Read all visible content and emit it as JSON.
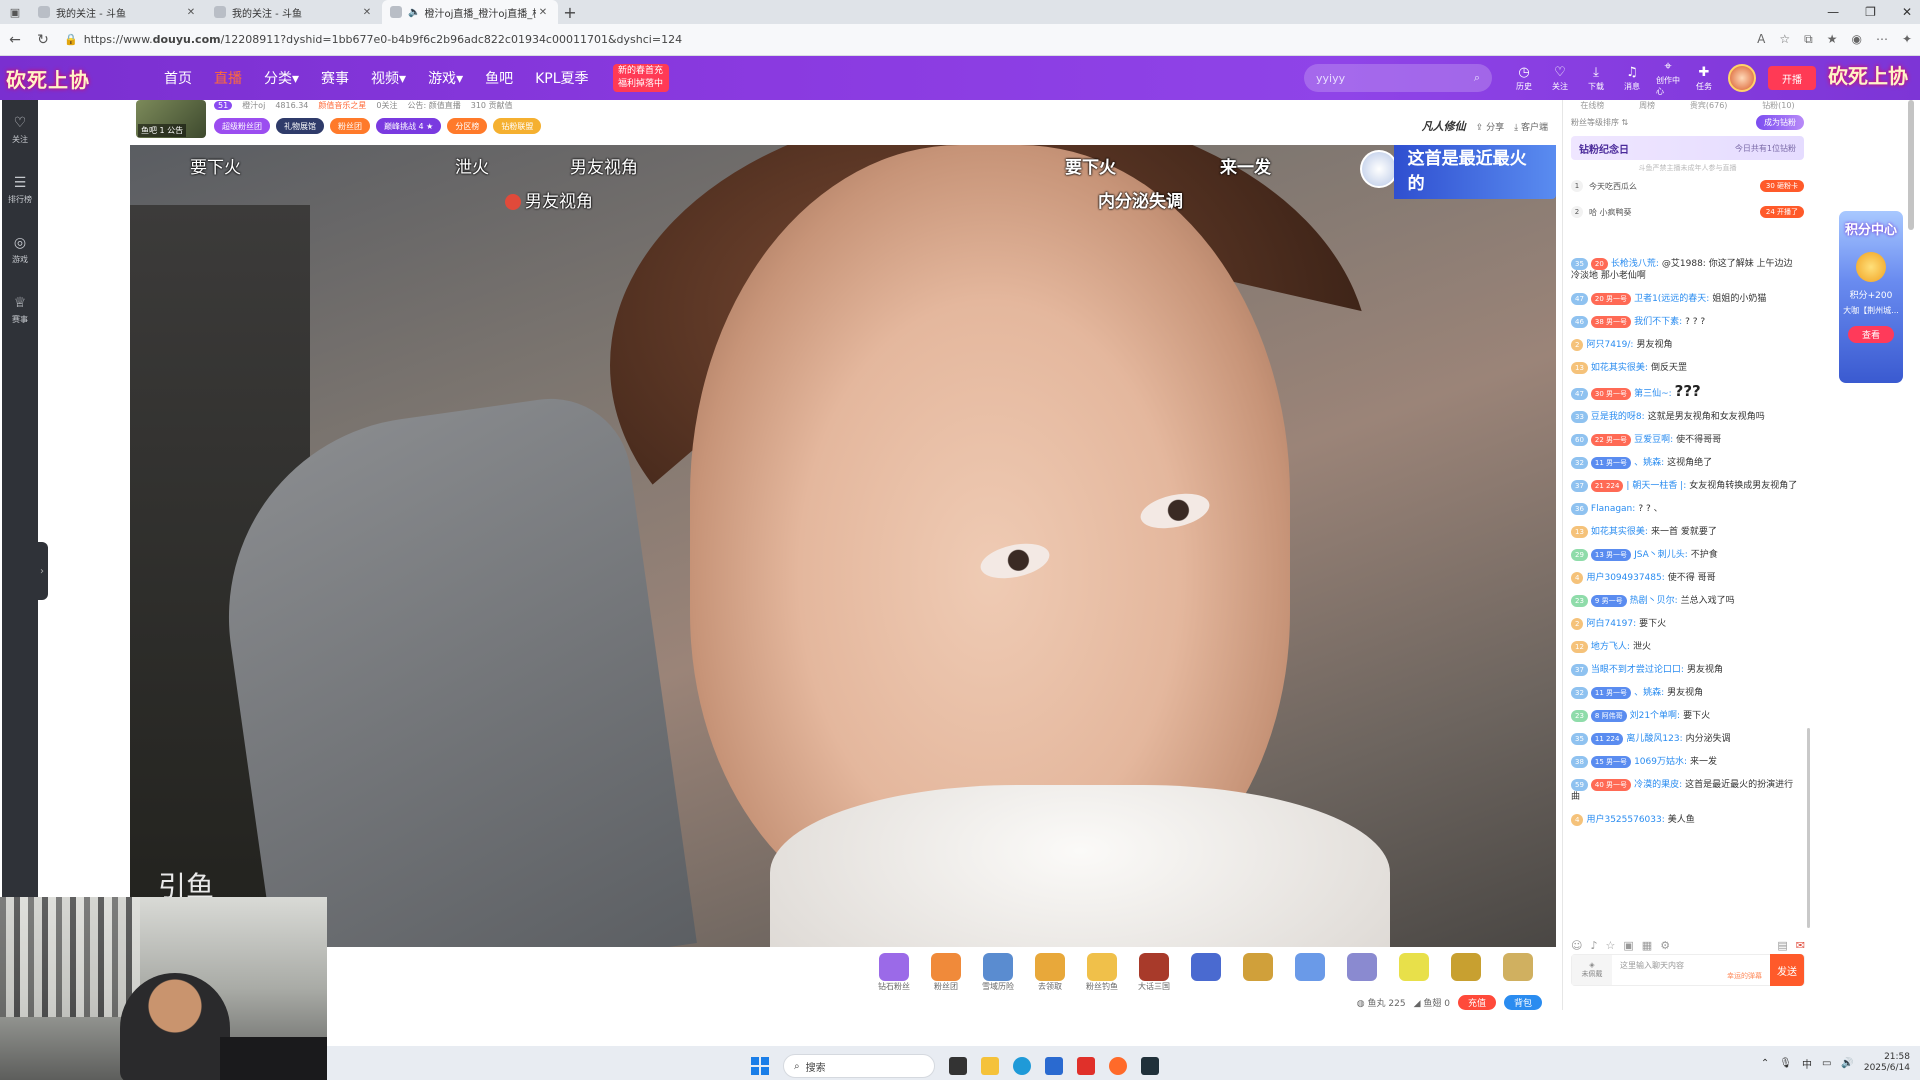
{
  "browser": {
    "tabs": [
      {
        "title": "我的关注 - 斗鱼",
        "active": false
      },
      {
        "title": "我的关注 - 斗鱼",
        "active": false
      },
      {
        "title": "橙汁oj直播_橙汁oj直播_橙汁",
        "active": true
      }
    ],
    "new_tab": "+",
    "url_prefix": "https://www.",
    "url_domain": "douyu.com",
    "url_path": "/12208911?dyshid=1bb677e0-b4b9f6c2b96adc822c01934c00011701&dyshci=124",
    "window_controls": [
      "—",
      "❐",
      "✕"
    ]
  },
  "header": {
    "logo_text": "砍死上协",
    "nav": [
      "首页",
      "直播",
      "分类",
      "赛事",
      "视频",
      "游戏",
      "鱼吧",
      "KPL夏季"
    ],
    "active_nav": "直播",
    "promo_line1": "新的春首充",
    "promo_line2": "福利掉落中",
    "search_value": "yyiyy",
    "right_icons": [
      "历史",
      "关注",
      "下载",
      "消息",
      "创作中心",
      "任务"
    ],
    "live_button": "开播",
    "banner_right": "砍死上协"
  },
  "leftbar": {
    "items": [
      {
        "icon": "heart-icon",
        "label": "关注"
      },
      {
        "icon": "list-icon",
        "label": "排行榜"
      },
      {
        "icon": "game-icon",
        "label": "游戏"
      },
      {
        "icon": "trophy-icon",
        "label": "赛事"
      }
    ]
  },
  "room": {
    "anchor_tag": "鱼吧 1 公告",
    "level": "51",
    "meta": [
      "橙汁oj",
      "4816.34",
      "颜值音乐之星",
      "0关注",
      "公告: 颜值直播",
      "310 贡献值"
    ],
    "badges": [
      {
        "label": "超级粉丝团",
        "color": "#9b4df0"
      },
      {
        "label": "礼物展馆",
        "color": "#2f3b6a"
      },
      {
        "label": "粉丝团",
        "color": "#ff7a2a"
      },
      {
        "label": "巅峰挑战  4 ★",
        "color": "#7a3ae0"
      },
      {
        "label": "分区榜",
        "color": "#ff7a2a"
      },
      {
        "label": "钻粉联盟",
        "color": "#f5b030"
      }
    ],
    "right_logo": "凡人修仙",
    "share": "分享",
    "client": "客户端"
  },
  "video": {
    "danmu": [
      {
        "text": "要下火",
        "bold": false
      },
      {
        "text": "泄火",
        "bold": false
      },
      {
        "text": "男友视角",
        "bold": false
      },
      {
        "text": "男友视角",
        "bold": false
      },
      {
        "text": "要下火",
        "bold": true
      },
      {
        "text": "来一发",
        "bold": true
      },
      {
        "text": "内分泌失调",
        "bold": true
      }
    ],
    "gift_banner": "这首是最近最火的",
    "corner_text": "引鱼"
  },
  "under_video": {
    "gifts": [
      {
        "label": "钻石粉丝",
        "color": "#9b6ae8"
      },
      {
        "label": "粉丝团",
        "color": "#f08a3a"
      },
      {
        "label": "雪域历险",
        "color": "#5a8cd0"
      },
      {
        "label": "去领取",
        "color": "#e8a83a"
      },
      {
        "label": "粉丝钓鱼",
        "color": "#f0c04a"
      },
      {
        "label": "大话三国",
        "color": "#a83a2a"
      },
      {
        "label": "",
        "color": "#4a6ad0"
      },
      {
        "label": "",
        "color": "#d0a03a"
      },
      {
        "label": "",
        "color": "#6a9ae8"
      },
      {
        "label": "",
        "color": "#8a8ad0"
      },
      {
        "label": "",
        "color": "#e8e04a"
      },
      {
        "label": "",
        "color": "#c8a030"
      },
      {
        "label": "",
        "color": "#d0b060"
      }
    ],
    "fish_balls": "鱼丸 225",
    "fish_wings": "鱼翅 0",
    "recharge": "充值",
    "backpack": "背包"
  },
  "chat": {
    "tabs": [
      "在线榜",
      "周榜",
      "贵宾(676)",
      "钻粉(10)"
    ],
    "rank_label": "粉丝等级排序",
    "rank_pill": "成为钻粉",
    "anniv_title": "钻粉纪念日",
    "anniv_sub": "今日共有1位钻粉",
    "sub_note": "斗鱼严禁主播未成年人参与直播",
    "rank_rows": [
      {
        "num": "1",
        "text": "今天吃西瓜么",
        "tag": "30 砸粉卡"
      },
      {
        "num": "2",
        "text": "哈 小疯鸭葵",
        "tag": "24 开播了"
      }
    ],
    "messages": [
      {
        "lv": "35",
        "fan": "20",
        "nick": "长枪浅八荒:",
        "text": "@艾1988: 你这了解妹 上午边边冷淡地 那小老仙啊",
        "lvc": "blue",
        "fanc": "red"
      },
      {
        "lv": "47",
        "fan": "20 男一号",
        "nick": "卫者1(远远的春天:",
        "text": "姐姐的小奶猫",
        "lvc": "blue",
        "fanc": "red"
      },
      {
        "lv": "46",
        "fan": "38 男一号",
        "nick": "我们不下素:",
        "text": "? ? ?",
        "lvc": "blue",
        "fanc": "red"
      },
      {
        "lv": "2",
        "fan": "",
        "nick": "阿只7419/:",
        "text": "男友视角",
        "lvc": "orange",
        "fanc": ""
      },
      {
        "lv": "13",
        "fan": "",
        "nick": "如花其实很美:",
        "text": "倒反天罡",
        "lvc": "orange",
        "fanc": ""
      },
      {
        "lv": "47",
        "fan": "30 男一号",
        "nick": "第三仙~:",
        "text": "???",
        "lvc": "blue",
        "fanc": "red"
      },
      {
        "lv": "33",
        "fan": "",
        "nick": "豆是我的呀8:",
        "text": "这就是男友视角和女友视角吗",
        "lvc": "blue",
        "fanc": ""
      },
      {
        "lv": "60",
        "fan": "22 男一号",
        "nick": "豆爱豆啊:",
        "text": "使不得哥哥",
        "lvc": "blue",
        "fanc": "red"
      },
      {
        "lv": "32",
        "fan": "11 男一号",
        "nick": "、姚森:",
        "text": "这视角绝了",
        "lvc": "blue",
        "fanc": "blue"
      },
      {
        "lv": "37",
        "fan": "21 224",
        "nick": "| 朝天一柱香 |:",
        "text": "女友视角转换成男友视角了",
        "lvc": "blue",
        "fanc": "red"
      },
      {
        "lv": "36",
        "fan": "",
        "nick": "Flanagan:",
        "text": "? ? 、",
        "lvc": "blue",
        "fanc": ""
      },
      {
        "lv": "13",
        "fan": "",
        "nick": "如花其实很美:",
        "text": "来一首  爱就要了",
        "lvc": "orange",
        "fanc": ""
      },
      {
        "lv": "29",
        "fan": "13 男一号",
        "nick": "JSA丶刺儿头:",
        "text": "不护食",
        "lvc": "green",
        "fanc": "blue"
      },
      {
        "lv": "4",
        "fan": "",
        "nick": "用户3094937485:",
        "text": "使不得 哥哥",
        "lvc": "orange",
        "fanc": ""
      },
      {
        "lv": "23",
        "fan": "9 男一号",
        "nick": "热剧丶贝尔:",
        "text": "兰总入戏了吗",
        "lvc": "green",
        "fanc": "blue"
      },
      {
        "lv": "2",
        "fan": "",
        "nick": "阿白74197:",
        "text": "要下火",
        "lvc": "orange",
        "fanc": ""
      },
      {
        "lv": "12",
        "fan": "",
        "nick": "地方飞人:",
        "text": "泄火",
        "lvc": "orange",
        "fanc": ""
      },
      {
        "lv": "37",
        "fan": "",
        "nick": "当眼不到才尝过论口口:",
        "text": "男友视角",
        "lvc": "blue",
        "fanc": ""
      },
      {
        "lv": "32",
        "fan": "11 男一号",
        "nick": "、姚森:",
        "text": "男友视角",
        "lvc": "blue",
        "fanc": "blue"
      },
      {
        "lv": "23",
        "fan": "8 阿伟哥",
        "nick": "刘21个单啊:",
        "text": "要下火",
        "lvc": "green",
        "fanc": "blue"
      },
      {
        "lv": "35",
        "fan": "11 224",
        "nick": "离儿酸风123:",
        "text": "内分泌失调",
        "lvc": "blue",
        "fanc": "blue"
      },
      {
        "lv": "38",
        "fan": "15 男一号",
        "nick": "1069万姑水:",
        "text": "来一发",
        "lvc": "blue",
        "fanc": "blue"
      },
      {
        "lv": "59",
        "fan": "40 男一号",
        "nick": "冷漠的果皮:",
        "text": "这首是最近最火的扮演进行曲",
        "lvc": "blue",
        "fanc": "red"
      },
      {
        "lv": "4",
        "fan": "",
        "nick": "用户3525576033:",
        "text": "美人鱼",
        "lvc": "orange",
        "fanc": ""
      }
    ],
    "input_placeholder": "这里输入聊天内容",
    "input_badge": "未佩戴",
    "input_tip": "幸运的弹幕",
    "send": "发送"
  },
  "side_promo": {
    "title": "积分中心",
    "points": "积分+200",
    "desc": "大咖【荆州城...",
    "see": "查看"
  },
  "taskbar": {
    "search_placeholder": "搜索",
    "tray_ime": "中",
    "time": "21:58",
    "date": "2025/6/14"
  }
}
